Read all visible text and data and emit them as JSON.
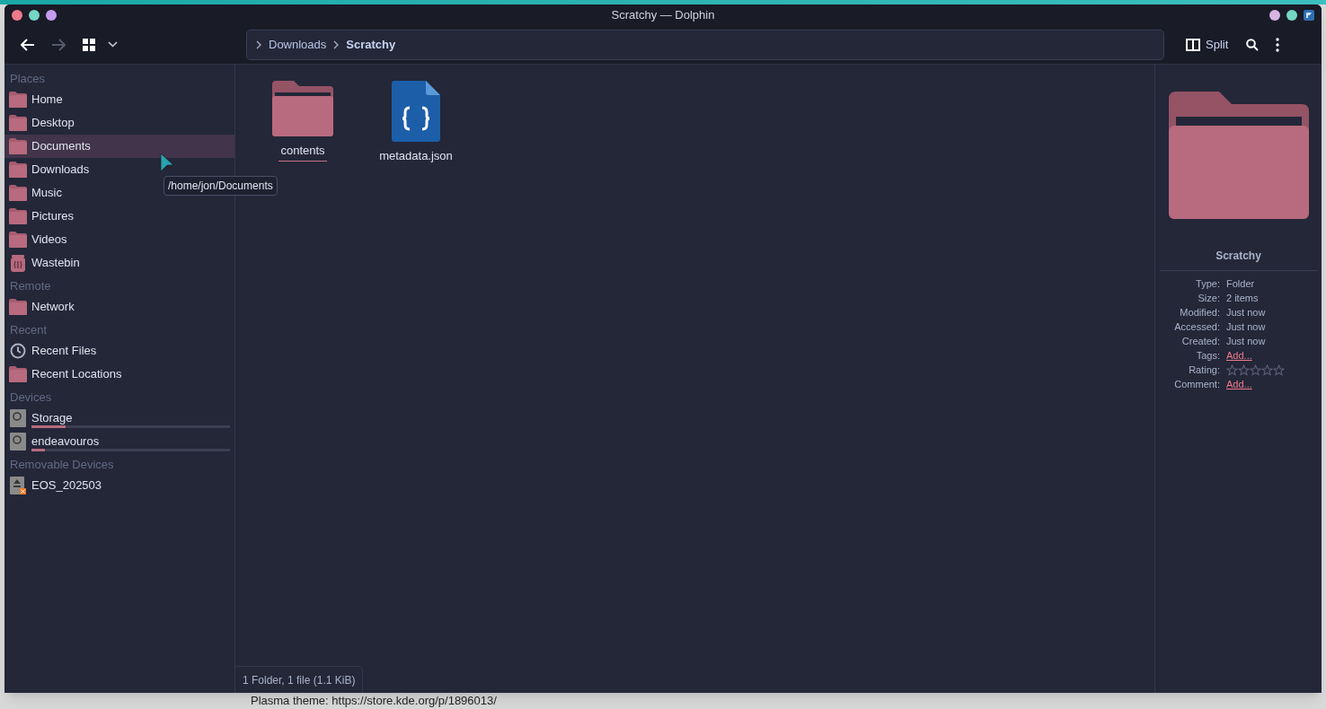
{
  "window": {
    "title": "Scratchy — Dolphin"
  },
  "toolbar": {
    "breadcrumb": [
      {
        "label": "Downloads",
        "current": false
      },
      {
        "label": "Scratchy",
        "current": true
      }
    ],
    "split_label": "Split"
  },
  "sidebar": {
    "sections": [
      {
        "title": "Places",
        "items": [
          {
            "label": "Home",
            "kind": "folder",
            "selected": false
          },
          {
            "label": "Desktop",
            "kind": "folder",
            "selected": false
          },
          {
            "label": "Documents",
            "kind": "folder",
            "selected": true
          },
          {
            "label": "Downloads",
            "kind": "folder",
            "selected": false
          },
          {
            "label": "Music",
            "kind": "folder",
            "selected": false
          },
          {
            "label": "Pictures",
            "kind": "folder",
            "selected": false
          },
          {
            "label": "Videos",
            "kind": "folder",
            "selected": false
          },
          {
            "label": "Wastebin",
            "kind": "trash",
            "selected": false
          }
        ]
      },
      {
        "title": "Remote",
        "items": [
          {
            "label": "Network",
            "kind": "folder",
            "selected": false
          }
        ]
      },
      {
        "title": "Recent",
        "items": [
          {
            "label": "Recent Files",
            "kind": "clock",
            "selected": false
          },
          {
            "label": "Recent Locations",
            "kind": "folder",
            "selected": false
          }
        ]
      },
      {
        "title": "Devices",
        "items": [
          {
            "label": "Storage",
            "kind": "drive",
            "selected": false,
            "level": 0.17
          },
          {
            "label": "endeavouros",
            "kind": "drive",
            "selected": false,
            "level": 0.07
          }
        ]
      },
      {
        "title": "Removable Devices",
        "items": [
          {
            "label": "EOS_202503",
            "kind": "removable",
            "selected": false
          }
        ]
      }
    ]
  },
  "tooltip": "/home/jon/Documents",
  "files": [
    {
      "name": "contents",
      "kind": "folder",
      "selected": true
    },
    {
      "name": "metadata.json",
      "kind": "json",
      "selected": false
    }
  ],
  "status_bar": "1 Folder, 1 file (1.1 KiB)",
  "info_panel": {
    "title": "Scratchy",
    "rows": [
      {
        "label": "Type:",
        "kind": "text",
        "value": "Folder"
      },
      {
        "label": "Size:",
        "kind": "text",
        "value": "2 items"
      },
      {
        "label": "Modified:",
        "kind": "text",
        "value": "Just now"
      },
      {
        "label": "Accessed:",
        "kind": "text",
        "value": "Just now"
      },
      {
        "label": "Created:",
        "kind": "text",
        "value": "Just now"
      },
      {
        "label": "Tags:",
        "kind": "link",
        "value": "Add..."
      },
      {
        "label": "Rating:",
        "kind": "rating",
        "stars": 0
      },
      {
        "label": "Comment:",
        "kind": "link",
        "value": "Add..."
      }
    ]
  },
  "desktop_text": "Plasma theme: https://store.kde.org/p/1896013/"
}
